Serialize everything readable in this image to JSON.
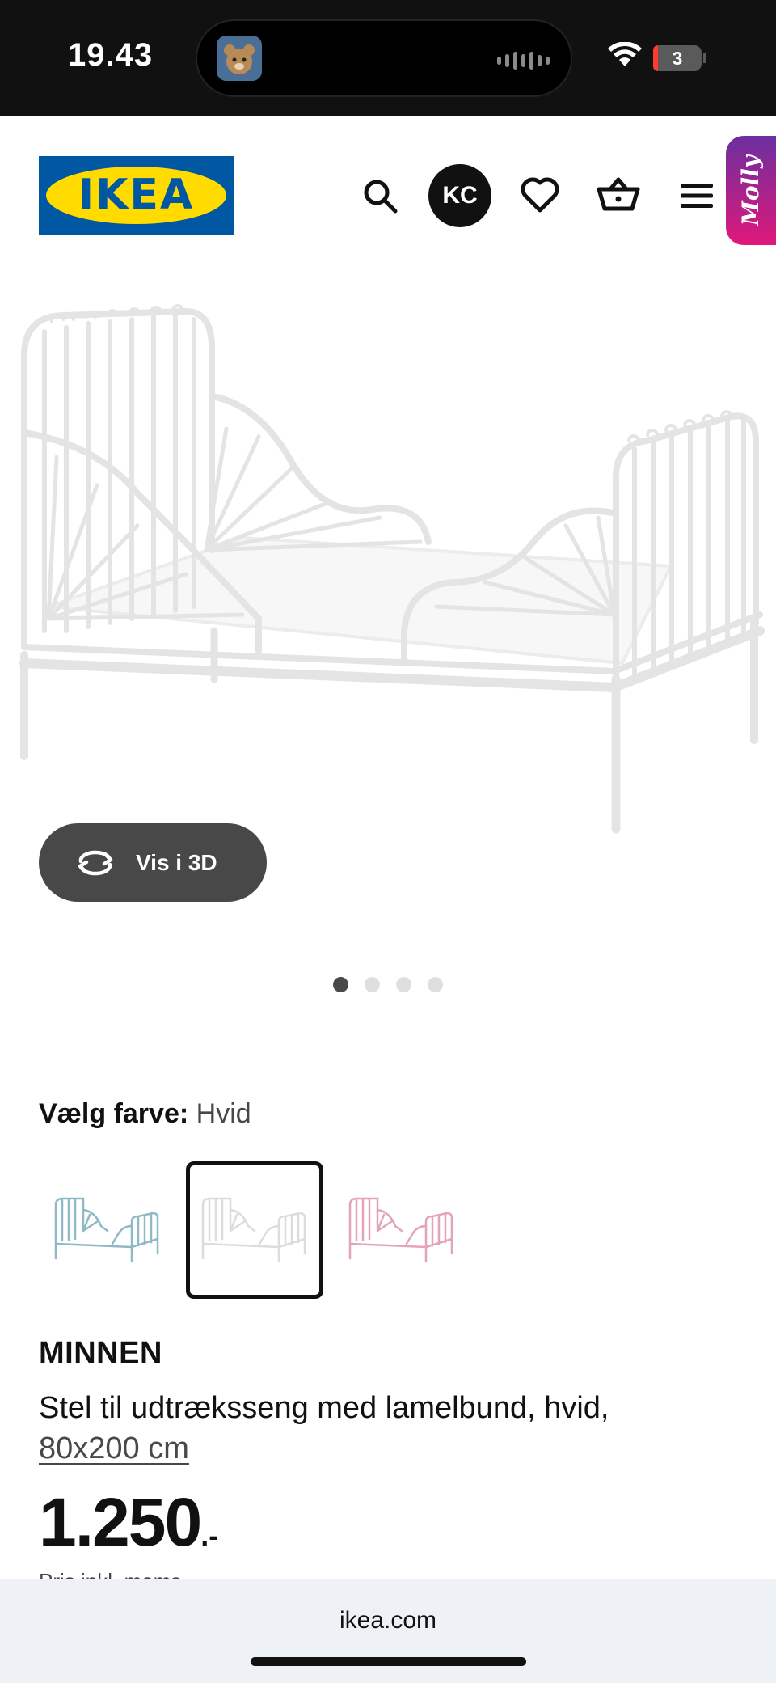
{
  "status_bar": {
    "time": "19.43",
    "battery_level": "3",
    "battery_color": "#ff3b30"
  },
  "header": {
    "logo_text": "IKEA",
    "avatar_initials": "KC",
    "assistant_label": "Molly",
    "icons": [
      "search-icon",
      "heart-icon",
      "basket-icon",
      "menu-icon"
    ]
  },
  "gallery": {
    "view_3d_label": "Vis i 3D",
    "image_count": 4,
    "active_index": 0
  },
  "color_picker": {
    "label": "Vælg farve:",
    "selected_value": "Hvid",
    "options": [
      {
        "name": "turquoise",
        "color": "#8fb9c7",
        "selected": false
      },
      {
        "name": "white",
        "color": "#e6e6e6",
        "selected": true
      },
      {
        "name": "pink",
        "color": "#e3a4bb",
        "selected": false
      }
    ]
  },
  "product": {
    "name": "MINNEN",
    "description": "Stel til udtræksseng med lamelbund, hvid,",
    "size_link": "80x200 cm",
    "price": "1.250",
    "price_suffix": ".-",
    "price_note": "Pris inkl. moms"
  },
  "browser": {
    "url": "ikea.com"
  },
  "theme": {
    "brand_blue": "#0058a3",
    "brand_yellow": "#ffdb00",
    "button_dark": "#484848"
  }
}
